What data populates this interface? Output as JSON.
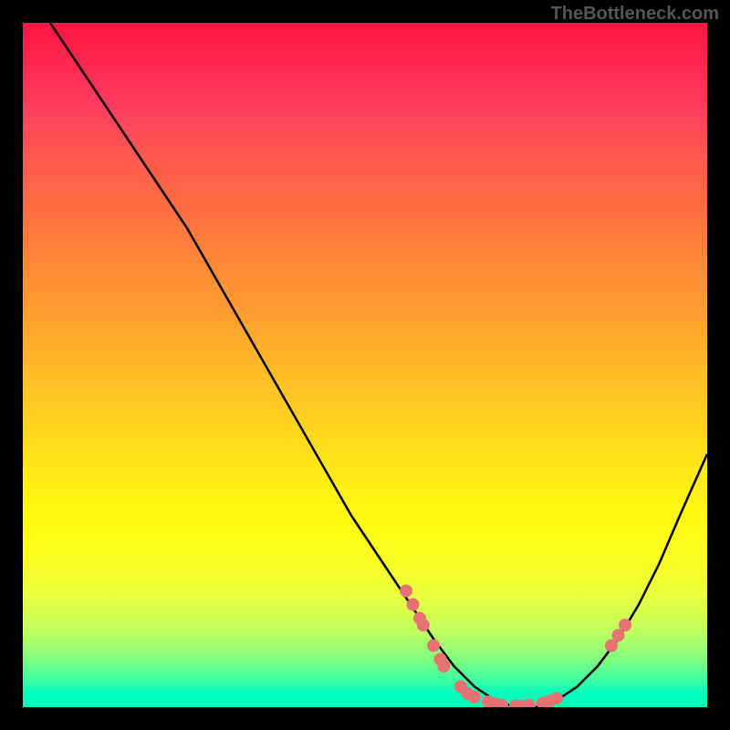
{
  "watermark": "TheBottleneck.com",
  "chart_data": {
    "type": "line",
    "title": "",
    "xlabel": "",
    "ylabel": "",
    "xlim": [
      0,
      100
    ],
    "ylim": [
      0,
      100
    ],
    "curve": {
      "x": [
        4,
        8,
        12,
        16,
        20,
        24,
        28,
        32,
        36,
        40,
        44,
        48,
        52,
        56,
        60,
        63,
        66,
        69,
        72,
        75,
        78,
        81,
        84,
        87,
        90,
        93,
        96,
        100
      ],
      "y": [
        100,
        94,
        88,
        82,
        76,
        70,
        63,
        56,
        49,
        42,
        35,
        28,
        22,
        16,
        10,
        6,
        3,
        1,
        0,
        0,
        1,
        3,
        6,
        10,
        15,
        21,
        28,
        37
      ]
    },
    "markers": [
      {
        "x": 56,
        "y": 17
      },
      {
        "x": 57,
        "y": 15
      },
      {
        "x": 58,
        "y": 13
      },
      {
        "x": 58.5,
        "y": 12
      },
      {
        "x": 60,
        "y": 9
      },
      {
        "x": 61,
        "y": 7
      },
      {
        "x": 61.5,
        "y": 6
      },
      {
        "x": 64,
        "y": 3
      },
      {
        "x": 65,
        "y": 2
      },
      {
        "x": 66,
        "y": 1.5
      },
      {
        "x": 68,
        "y": 0.8
      },
      {
        "x": 69,
        "y": 0.5
      },
      {
        "x": 70,
        "y": 0.3
      },
      {
        "x": 72,
        "y": 0.2
      },
      {
        "x": 73,
        "y": 0.2
      },
      {
        "x": 74,
        "y": 0.3
      },
      {
        "x": 76,
        "y": 0.6
      },
      {
        "x": 77,
        "y": 0.9
      },
      {
        "x": 78,
        "y": 1.3
      },
      {
        "x": 86,
        "y": 9
      },
      {
        "x": 87,
        "y": 10.5
      },
      {
        "x": 88,
        "y": 12
      }
    ],
    "gradient_stops": [
      {
        "pos": 0,
        "color": "#ff1744"
      },
      {
        "pos": 50,
        "color": "#ffd020"
      },
      {
        "pos": 100,
        "color": "#00ffb0"
      }
    ]
  }
}
